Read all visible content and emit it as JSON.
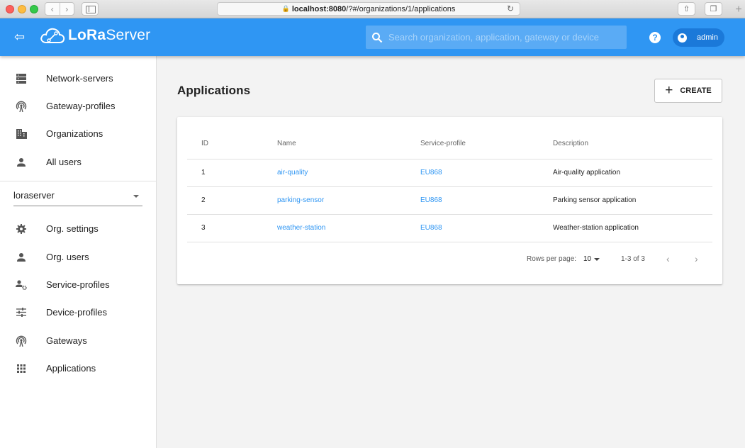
{
  "browser": {
    "url_host": "localhost:8080",
    "url_path": "/?#/organizations/1/applications"
  },
  "appbar": {
    "logo_bold": "LoRa",
    "logo_rest": "Server",
    "search_placeholder": "Search organization, application, gateway or device",
    "user": "admin",
    "help_glyph": "?"
  },
  "sidebar": {
    "top_items": [
      {
        "label": "Network-servers",
        "icon": "server-icon"
      },
      {
        "label": "Gateway-profiles",
        "icon": "radio-tower-icon"
      },
      {
        "label": "Organizations",
        "icon": "domain-icon"
      },
      {
        "label": "All users",
        "icon": "person-icon"
      }
    ],
    "org_select": "loraserver",
    "org_items": [
      {
        "label": "Org. settings",
        "icon": "gear-icon"
      },
      {
        "label": "Org. users",
        "icon": "person-icon"
      },
      {
        "label": "Service-profiles",
        "icon": "account-settings-icon"
      },
      {
        "label": "Device-profiles",
        "icon": "tune-icon"
      },
      {
        "label": "Gateways",
        "icon": "radio-tower-icon"
      },
      {
        "label": "Applications",
        "icon": "apps-grid-icon"
      }
    ]
  },
  "main": {
    "title": "Applications",
    "create_label": "CREATE",
    "table": {
      "columns": [
        "ID",
        "Name",
        "Service-profile",
        "Description"
      ],
      "rows": [
        {
          "id": "1",
          "name": "air-quality",
          "service_profile": "EU868",
          "description": "Air-quality application"
        },
        {
          "id": "2",
          "name": "parking-sensor",
          "service_profile": "EU868",
          "description": "Parking sensor application"
        },
        {
          "id": "3",
          "name": "weather-station",
          "service_profile": "EU868",
          "description": "Weather-station application"
        }
      ]
    },
    "pagination": {
      "rows_per_page_label": "Rows per page:",
      "rows_per_page": "10",
      "range": "1-3 of 3"
    }
  },
  "colors": {
    "appbar": "#2f96f3",
    "link": "#2f96f3",
    "background": "#f3f3f3"
  }
}
